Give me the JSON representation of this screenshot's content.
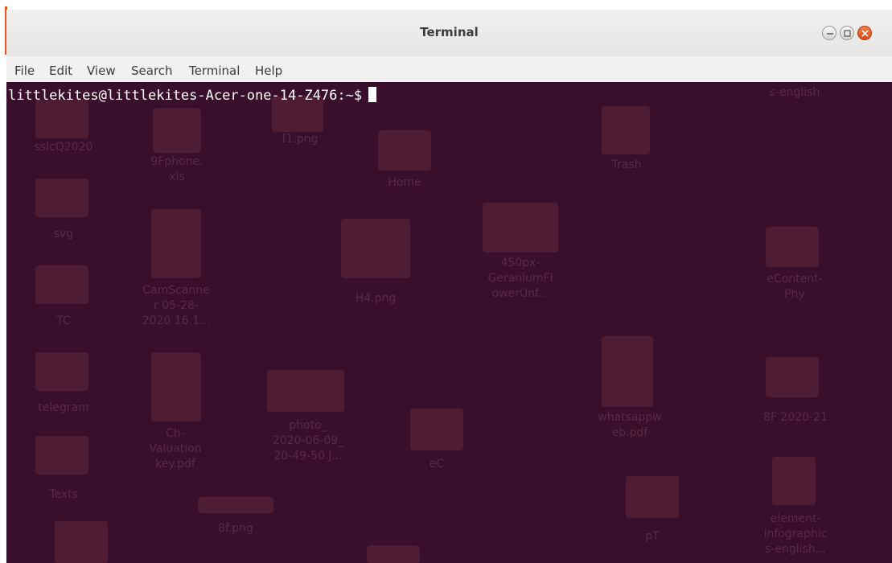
{
  "window": {
    "title": "Terminal"
  },
  "menu": {
    "items": [
      "File",
      "Edit",
      "View",
      "Search",
      "Terminal",
      "Help"
    ]
  },
  "terminal": {
    "prompt": "littlekites@littlekites-Acer-one-14-Z476:~$"
  },
  "desktop_icons": [
    {
      "label": "sslcQ2020"
    },
    {
      "label": "9Fphone.\nxls"
    },
    {
      "label": "f1.png"
    },
    {
      "label": "Home"
    },
    {
      "label": "Trash"
    },
    {
      "label": "s-english"
    },
    {
      "label": "svg"
    },
    {
      "label": "TC"
    },
    {
      "label": "CamScanne\nr 05-28-\n2020 16.1..."
    },
    {
      "label": "H4.png"
    },
    {
      "label": "450px-\nGeraniumFl\nowerUnf..."
    },
    {
      "label": "eContent-\nPhy"
    },
    {
      "label": "telegram"
    },
    {
      "label": "Ch-\nValuation\nkey.pdf"
    },
    {
      "label": "photo_\n2020-06-09_\n20-49-50.j..."
    },
    {
      "label": "eC"
    },
    {
      "label": "whatsappw\neb.pdf"
    },
    {
      "label": "8F 2020-21"
    },
    {
      "label": "Texts"
    },
    {
      "label": "8f.png"
    },
    {
      "label": "pT"
    },
    {
      "label": "element-\ninfographic\ns-english..."
    }
  ],
  "colors": {
    "terminal_bg": "#3a0f2c",
    "text": "#ffffff",
    "close_button": "#df4a15"
  }
}
